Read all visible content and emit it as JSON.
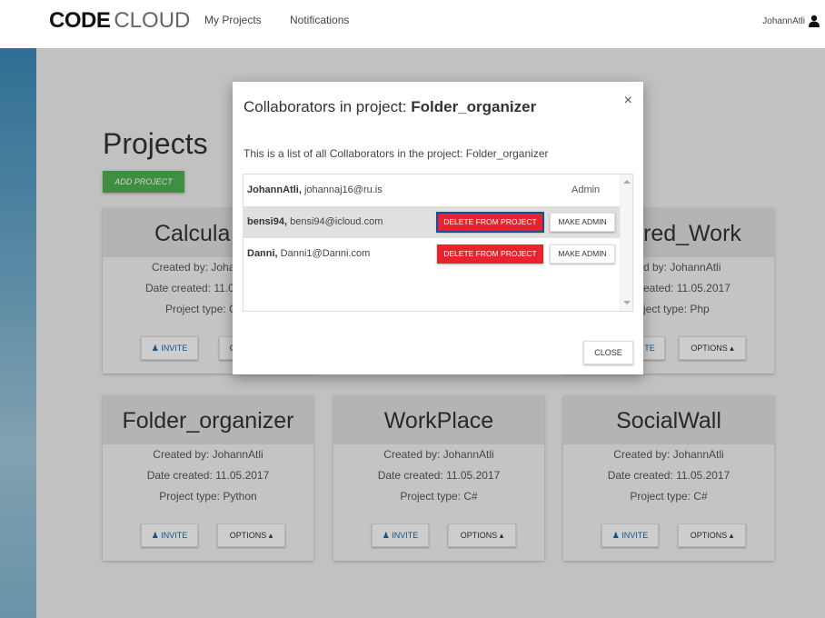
{
  "navbar": {
    "logo_bold": "CODE",
    "logo_light": "CLOUD",
    "links": [
      "My Projects",
      "Notifications"
    ],
    "username": "JohannAtli",
    "user_icon": "user-icon"
  },
  "page": {
    "title": "Projects",
    "add_project_label": "ADD PROJECT"
  },
  "cards": [
    {
      "name": "Calcula",
      "created_by": "Created by: Joha",
      "date": "Date created: 11.0",
      "type": "Project type: C",
      "invite": "INVITE",
      "options": "C"
    },
    {
      "name": "red_Work",
      "created_by": "d by: JohannAtli",
      "date": "eated: 11.05.2017",
      "type": "ject type: Php",
      "invite": "TE",
      "options": "OPTIONS ▴"
    },
    {
      "name": "Folder_organizer",
      "created_by": "Created by: JohannAtli",
      "date": "Date created: 11.05.2017",
      "type": "Project type: Python",
      "invite": "INVITE",
      "options": "OPTIONS ▴"
    },
    {
      "name": "WorkPlace",
      "created_by": "Created by: JohannAtli",
      "date": "Date created: 11.05.2017",
      "type": "Project type: C#",
      "invite": "INVITE",
      "options": "OPTIONS ▴"
    },
    {
      "name": "SocialWall",
      "created_by": "Created by: JohannAtli",
      "date": "Date created: 11.05.2017",
      "type": "Project type: C#",
      "invite": "INVITE",
      "options": "OPTIONS ▴"
    }
  ],
  "modal": {
    "title_prefix": "Collaborators in project: ",
    "title_project": "Folder_organizer",
    "close_x": "×",
    "description": "This is a list of all Collaborators in the project: Folder_organizer",
    "collaborators": [
      {
        "username": "JohannAtli,",
        "email": " johannaj16@ru.is",
        "role": "Admin"
      },
      {
        "username": "bensi94,",
        "email": " bensi94@icloud.com",
        "delete_label": "DELETE FROM PROJECT",
        "admin_label": "MAKE ADMIN"
      },
      {
        "username": "Danni,",
        "email": " Danni1@Danni.com",
        "delete_label": "DELETE FROM PROJECT",
        "admin_label": "MAKE ADMIN"
      }
    ],
    "close_label": "CLOSE"
  },
  "colors": {
    "add_project": "#4caf50",
    "delete_button": "#e8232b",
    "invite_text": "#1e63a8"
  }
}
